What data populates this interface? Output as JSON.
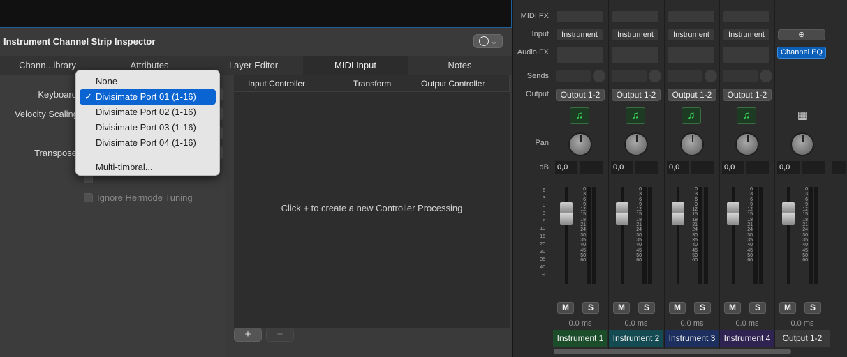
{
  "inspector": {
    "title": "Instrument Channel Strip Inspector",
    "more_glyph": "⋯",
    "chevron": "⌄",
    "tabs": [
      "Chann...ibrary",
      "Attributes",
      "Layer Editor",
      "MIDI Input",
      "Notes"
    ],
    "active_tab": "MIDI Input",
    "params": {
      "keyboard": "Keyboard",
      "velocity_scaling": "Velocity Scaling",
      "transpose": "Transpose",
      "ignore_hermode": "Ignore Hermode Tuning"
    },
    "controller_table": {
      "columns": [
        "Input Controller",
        "Transform",
        "Output Controller"
      ],
      "empty_message": "Click + to create a new Controller Processing"
    },
    "footer": {
      "add_label": "+",
      "remove_label": "−"
    }
  },
  "popup_menu": {
    "items": [
      "None",
      "Divisimate Port 01 (1-16)",
      "Divisimate Port 02 (1-16)",
      "Divisimate Port 03 (1-16)",
      "Divisimate Port 04 (1-16)"
    ],
    "selected": "Divisimate Port 01 (1-16)",
    "check_glyph": "✓",
    "extra_item": "Multi-timbral..."
  },
  "mixer": {
    "row_labels": {
      "midi_fx": "MIDI FX",
      "input": "Input",
      "audio_fx": "Audio FX",
      "sends": "Sends",
      "output": "Output",
      "pan": "Pan",
      "db": "dB"
    },
    "fader_scale": [
      "0",
      "3",
      "6",
      "9",
      "12",
      "15",
      "18",
      "21",
      "24",
      "30",
      "35",
      "40",
      "45",
      "50",
      "60"
    ],
    "left_scale": [
      "6",
      "3",
      "0",
      "3",
      "6",
      "10",
      "15",
      "20",
      "30",
      "35",
      "40",
      "∞"
    ],
    "strips": [
      {
        "input": "Instrument",
        "output": "Output 1-2",
        "db": "0,0",
        "mute": "M",
        "solo": "S",
        "delay": "0.0 ms",
        "name": "Instrument 1",
        "name_color": "#1b4d2a",
        "icon": "music-note-icon",
        "icon_glyph": "♫"
      },
      {
        "input": "Instrument",
        "output": "Output 1-2",
        "db": "0,0",
        "mute": "M",
        "solo": "S",
        "delay": "0.0 ms",
        "name": "Instrument 2",
        "name_color": "#144b52",
        "icon": "music-note-icon",
        "icon_glyph": "♫"
      },
      {
        "input": "Instrument",
        "output": "Output 1-2",
        "db": "0,0",
        "mute": "M",
        "solo": "S",
        "delay": "0.0 ms",
        "name": "Instrument 3",
        "name_color": "#1c2f5e",
        "icon": "music-note-icon",
        "icon_glyph": "♫"
      },
      {
        "input": "Instrument",
        "output": "Output 1-2",
        "db": "0,0",
        "mute": "M",
        "solo": "S",
        "delay": "0.0 ms",
        "name": "Instrument 4",
        "name_color": "#2f2352",
        "icon": "music-note-icon",
        "icon_glyph": "♫"
      },
      {
        "input_link": "⊕",
        "plugin": "Channel EQ",
        "db": "0,0",
        "mute": "M",
        "solo": "S",
        "delay": "0.0 ms",
        "name": "Output 1-2",
        "name_color": "#3a3a3a",
        "icon": "keyboard-icon",
        "icon_glyph": "▦"
      }
    ]
  }
}
